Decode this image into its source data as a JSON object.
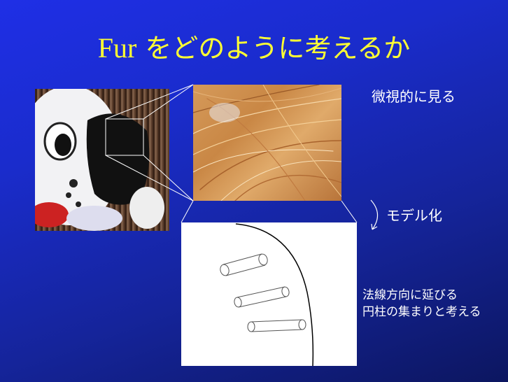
{
  "slide": {
    "title_latin": "Fur",
    "title_japanese": "をどのように考えるか",
    "micro_label": "微視的に見る",
    "model_label": "モデル化",
    "description_line1": "法線方向に延びる",
    "description_line2": "円柱の集まりと考える"
  },
  "colors": {
    "background": "#1a2ccc",
    "title": "#ffff33",
    "text": "#ffffff",
    "connector": "#ffffff"
  },
  "images": {
    "mascot": "mascot-photo",
    "fur": "fur-closeup-photo"
  }
}
